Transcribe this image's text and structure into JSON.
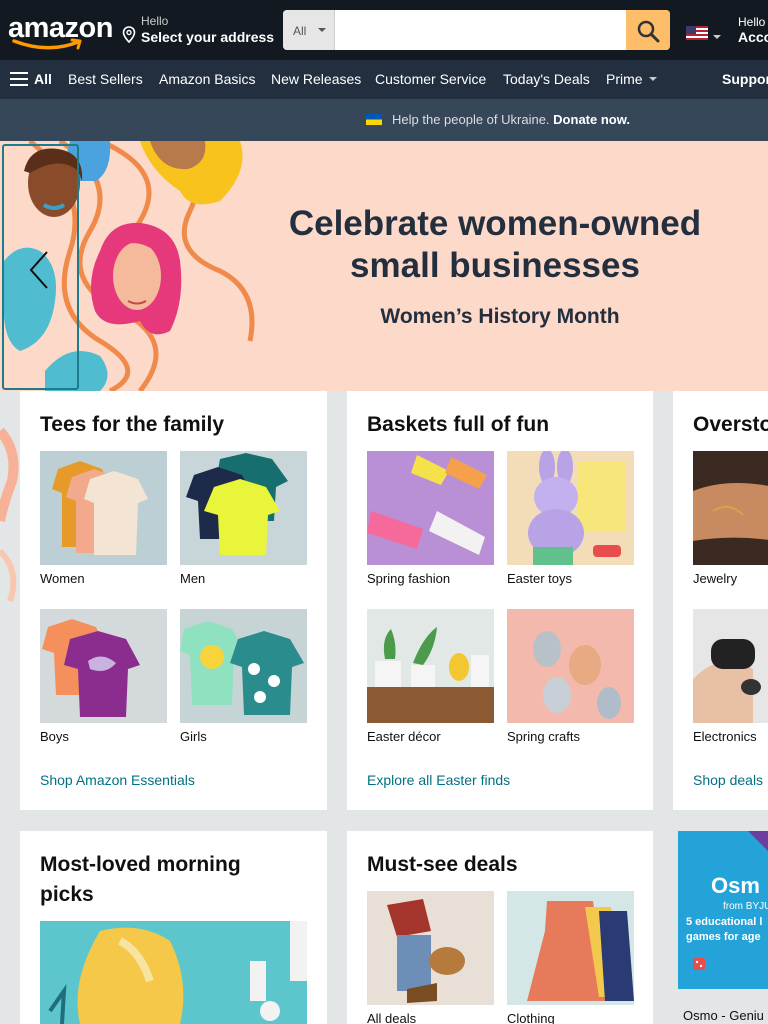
{
  "header": {
    "logo_text": "amazon",
    "address_line1": "Hello",
    "address_line2": "Select your address",
    "search_category": "All",
    "search_placeholder": "",
    "account_line1": "Hello",
    "account_line2": "Acco"
  },
  "subnav": {
    "all_label": "All",
    "items": [
      "Best Sellers",
      "Amazon Basics",
      "New Releases",
      "Customer Service",
      "Today's Deals",
      "Prime"
    ],
    "right_label": "Suppor"
  },
  "banner": {
    "text": "Help the people of Ukraine.",
    "link": "Donate now."
  },
  "hero": {
    "title": "Celebrate women-owned small businesses",
    "subtitle": "Women’s History Month"
  },
  "cards": [
    {
      "title": "Tees for the family",
      "tiles": [
        "Women",
        "Men",
        "Boys",
        "Girls"
      ],
      "link": "Shop Amazon Essentials"
    },
    {
      "title": "Baskets full of fun",
      "tiles": [
        "Spring fashion",
        "Easter toys",
        "Easter décor",
        "Spring crafts"
      ],
      "link": "Explore all Easter finds"
    },
    {
      "title": "Oversto",
      "tiles": [
        "Jewelry",
        "Electronics"
      ],
      "link": "Shop deals"
    },
    {
      "title": "Most-loved morning picks"
    },
    {
      "title": "Must-see deals",
      "tiles": [
        "All deals",
        "Clothing"
      ]
    }
  ],
  "osmo_ad": {
    "brand": "Osm",
    "from": "from BYJU",
    "tagline_1": "5 educational l",
    "tagline_2": "games for age",
    "caption": "Osmo - Geniu"
  },
  "colors": {
    "nav_dark": "#131921",
    "nav_sub": "#232f3e",
    "search_button": "#febd69",
    "link": "#007185",
    "hero_bg": "#fcd9c9"
  }
}
